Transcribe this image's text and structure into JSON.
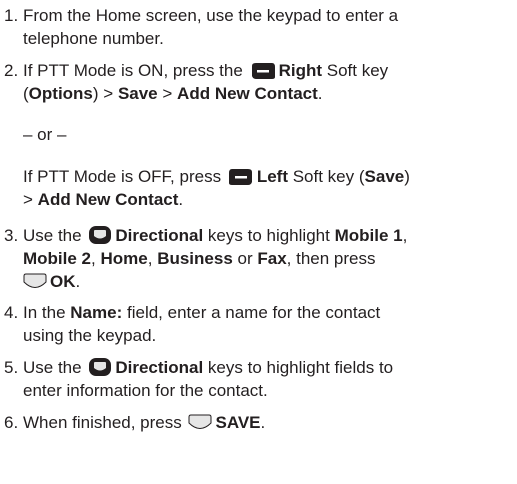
{
  "steps": [
    {
      "num": "1.",
      "line1": "From the Home screen, use the keypad to enter a",
      "line2": "telephone number."
    },
    {
      "num": "2.",
      "pre": "If PTT Mode is ON, press the",
      "key": "Right",
      "post": "Soft key",
      "l2_open": "(",
      "l2_b1": "Options",
      "l2_t1": ") >",
      "l2_b2": "Save",
      "l2_t2": ">",
      "l2_b3": "Add New Contact",
      "l2_t3": "."
    },
    {
      "or": "– or –"
    },
    {
      "pre": "If PTT Mode is OFF, press",
      "key": "Left",
      "post": "Soft key (",
      "b1": "Save",
      "t1": ")",
      "l2_t0": ">",
      "l2_b1": "Add New Contact",
      "l2_t1": "."
    },
    {
      "num": "3.",
      "pre": "Use the",
      "key": "Directional",
      "post": "keys to highlight",
      "b1": "Mobile 1",
      "l2_b1": "Mobile 2",
      "l2_t1": ",",
      "l2_b2": "Home",
      "l2_t2": ",",
      "l2_b3": "Business",
      "l2_t3": "or",
      "l2_b4": "Fax",
      "l2_t4": ", then press",
      "l3_b1": "OK",
      "l3_t1": "."
    },
    {
      "num": "4.",
      "pre": "In the",
      "b1": "Name:",
      "post": "field, enter a name for the contact",
      "line2": "using the keypad."
    },
    {
      "num": "5.",
      "pre": "Use the",
      "key": "Directional",
      "post": "keys to highlight fields to",
      "line2": "enter information for the contact."
    },
    {
      "num": "6.",
      "pre": "When finished, press",
      "b1": "SAVE",
      "t1": "."
    }
  ],
  "icons": {
    "right": "right-softkey-icon",
    "left": "left-softkey-icon",
    "nav": "directional-key-icon",
    "ok": "ok-key-icon",
    "color_dark": "#231f20",
    "color_light": "#e6e6e6"
  }
}
